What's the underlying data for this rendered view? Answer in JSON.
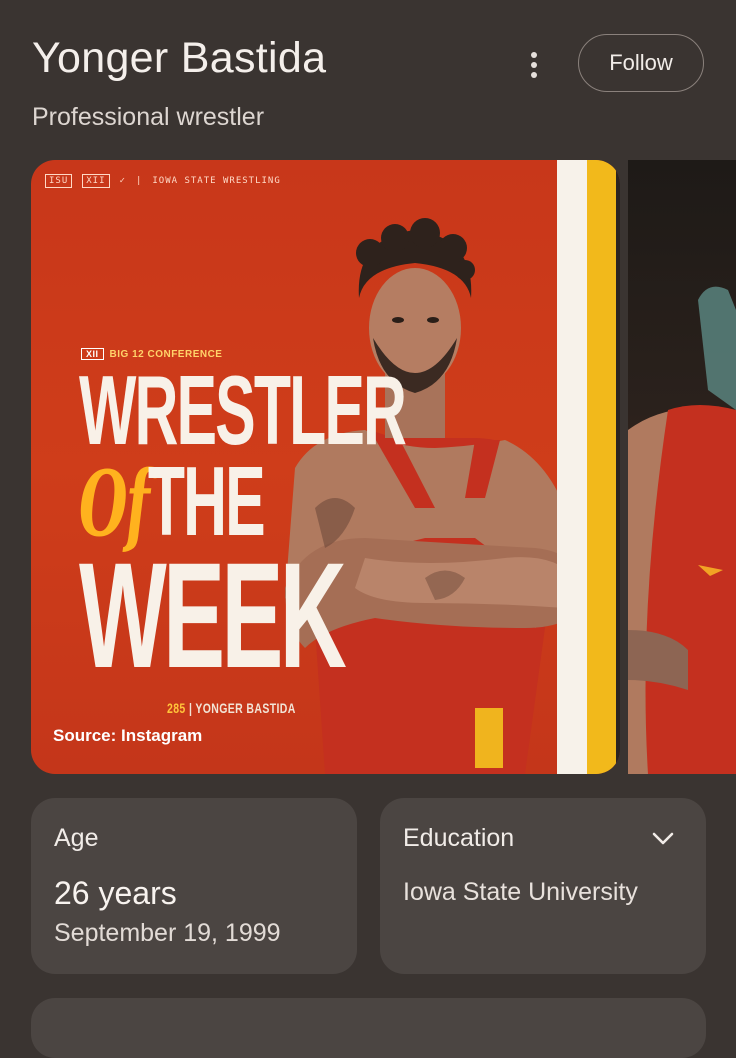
{
  "header": {
    "name": "Yonger Bastida",
    "subtitle": "Professional wrestler",
    "more_icon": "more-vert-icon",
    "follow_label": "Follow"
  },
  "carousel": {
    "main_image": {
      "top_banner": "IOWA STATE WRESTLING",
      "conference": "BIG 12 CONFERENCE",
      "headline_line1": "WRESTLER",
      "headline_of": "Of",
      "headline_the": "THE",
      "headline_line3": "WEEK",
      "caption_weight": "285",
      "caption_name": "| YONGER BASTIDA",
      "source": "Source: Instagram"
    }
  },
  "cards": {
    "age": {
      "label": "Age",
      "value": "26 years",
      "date": "September 19, 1999"
    },
    "education": {
      "label": "Education",
      "value": "Iowa State University",
      "expand_icon": "chevron-down-icon"
    }
  },
  "colors": {
    "background": "#3a3431",
    "card": "#4b4542",
    "image_red": "#cf3d1a",
    "gold": "#f2b91b"
  }
}
